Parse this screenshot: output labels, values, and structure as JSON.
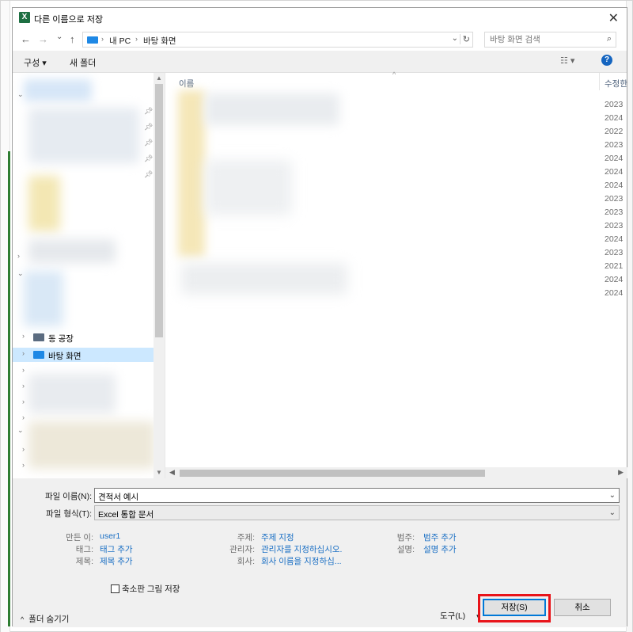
{
  "window": {
    "title": "다른 이름으로 저장",
    "app_icon": "excel-icon",
    "close_glyph": "✕"
  },
  "address_bar": {
    "back_glyph": "←",
    "forward_glyph": "→",
    "history_glyph": "⌄",
    "up_glyph": "↑",
    "crumbs": [
      "내 PC",
      "바탕 화면"
    ],
    "crumb_sep": "›",
    "dropdown_glyph": "⌄",
    "refresh_glyph": "↻"
  },
  "search": {
    "placeholder": "바탕 화면 검색",
    "icon": "search-icon",
    "icon_glyph": "⌕"
  },
  "toolbar": {
    "organize_label": "구성 ▾",
    "new_folder_label": "새 폴더",
    "view_glyph": "☷ ▾",
    "help_glyph": "?"
  },
  "nav_pane": {
    "partial_item_label": "동 공장",
    "selected_item_label": "바탕 화면"
  },
  "file_list": {
    "column_name": "이름",
    "column_modified": "수정한 날짜",
    "sort_glyph": "^",
    "dates": [
      "2023",
      "2024",
      "2022",
      "2023",
      "2024",
      "2024",
      "2024",
      "2023",
      "2023",
      "2023",
      "2024",
      "2023",
      "2021",
      "2024",
      "2024"
    ]
  },
  "form": {
    "filename_label": "파일 이름(N):",
    "filename_value": "견적서 예시",
    "filetype_label": "파일 형식(T):",
    "filetype_value": "Excel 통합 문서",
    "dropdown_glyph": "⌄",
    "meta": {
      "author_key": "만든 이:",
      "author_value": "user1",
      "tags_key": "태그:",
      "tags_value": "태그 추가",
      "title_key": "제목:",
      "title_value": "제목 추가",
      "subject_key": "주제:",
      "subject_value": "주제 지정",
      "manager_key": "관리자:",
      "manager_value": "관리자를 지정하십시오.",
      "company_key": "회사:",
      "company_value": "회사 이름을 지정하십...",
      "category_key": "범주:",
      "category_value": "범주 추가",
      "comments_key": "설명:",
      "comments_value": "설명 추가"
    },
    "thumbnail_label": "축소판 그림 저장",
    "hide_folders_label": "폴더 숨기기",
    "hide_folders_glyph": "^",
    "tools_label": "도구(L)",
    "tools_glyph": "▾",
    "save_label": "저장(S)",
    "cancel_label": "취소"
  },
  "colors": {
    "accent": "#0078d7",
    "highlight": "#e8141a",
    "selection": "#cce8ff",
    "link": "#1a6fc4"
  }
}
